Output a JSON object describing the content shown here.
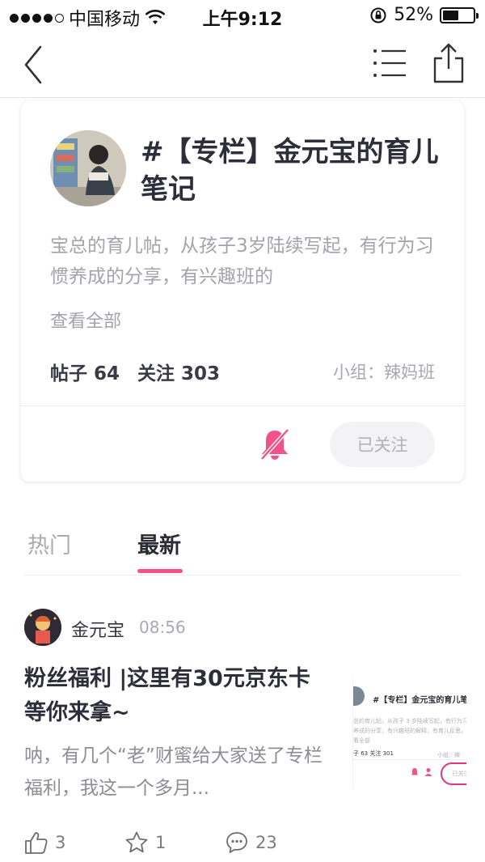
{
  "status_bar": {
    "carrier": "中国移动",
    "time": "上午9:12",
    "battery": "52%",
    "battery_level": 0.52
  },
  "nav": {
    "icons": [
      "back-icon",
      "list-icon",
      "share-icon"
    ]
  },
  "column": {
    "title": "#【专栏】金元宝的育儿笔记",
    "description": "宝总的育儿帖，从孩子3岁陆续写起，有行为习惯养成的分享，有兴趣班的",
    "view_all": "查看全部",
    "posts_label": "帖子 64",
    "followers_label": "关注 303",
    "group_label": "小组：辣妈班",
    "follow_button": "已关注"
  },
  "tabs": [
    {
      "label": "热门",
      "active": false
    },
    {
      "label": "最新",
      "active": true
    }
  ],
  "post": {
    "author": "金元宝",
    "time": "08:56",
    "title": "粉丝福利 |这里有30元京东卡等你来拿~",
    "excerpt": "呐，有几个“老”财蜜给大家送了专栏福利，我这一个多月...",
    "thumbnail": {
      "title": "#【专栏】金元宝的育儿笔记",
      "line1": "总的育儿帖，从孩子 3 岁陆续写起，有行为习",
      "line2": "养成的分享，有兴趣班的解释，有育儿反思，",
      "line3": "看全部",
      "stats": "子 63   关注 301",
      "group": "小组：辣",
      "follow": "已关注"
    },
    "likes": "3",
    "stars": "1",
    "comments": "23"
  },
  "colors": {
    "accent": "#f2528a",
    "text_primary": "#2e2e3a",
    "text_secondary": "#a3a3ab"
  }
}
